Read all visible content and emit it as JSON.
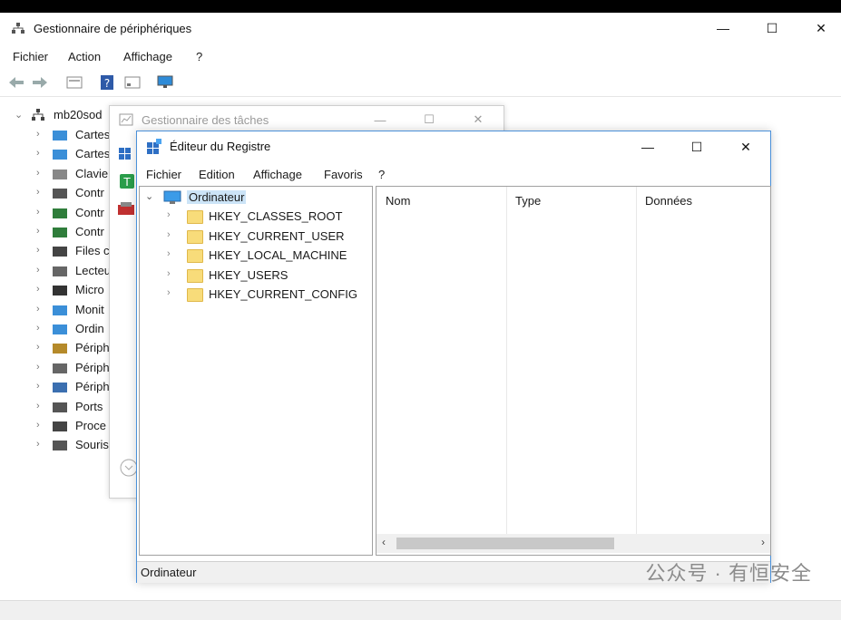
{
  "device_manager": {
    "title": "Gestionnaire de périphériques",
    "menu": [
      "Fichier",
      "Action",
      "Affichage",
      "?"
    ],
    "root": "mb20sod",
    "items": [
      "Cartes",
      "Cartes",
      "Clavie",
      "Contr",
      "Contr",
      "Contr",
      "Files c",
      "Lecteu",
      "Micro",
      "Monit",
      "Ordin",
      "Périph",
      "Périph",
      "Périph",
      "Ports",
      "Proce",
      "Souris"
    ]
  },
  "task_manager": {
    "title": "Gestionnaire des tâches"
  },
  "registry_editor": {
    "title": "Éditeur du Registre",
    "menu": [
      "Fichier",
      "Edition",
      "Affichage",
      "Favoris",
      "?"
    ],
    "tree_root": "Ordinateur",
    "hives": [
      "HKEY_CLASSES_ROOT",
      "HKEY_CURRENT_USER",
      "HKEY_LOCAL_MACHINE",
      "HKEY_USERS",
      "HKEY_CURRENT_CONFIG"
    ],
    "columns": [
      "Nom",
      "Type",
      "Données"
    ],
    "status": "Ordinateur"
  },
  "window_controls": {
    "minimize": "—",
    "maximize": "☐",
    "close": "✕"
  },
  "watermark": "公众号 · 有恒安全"
}
